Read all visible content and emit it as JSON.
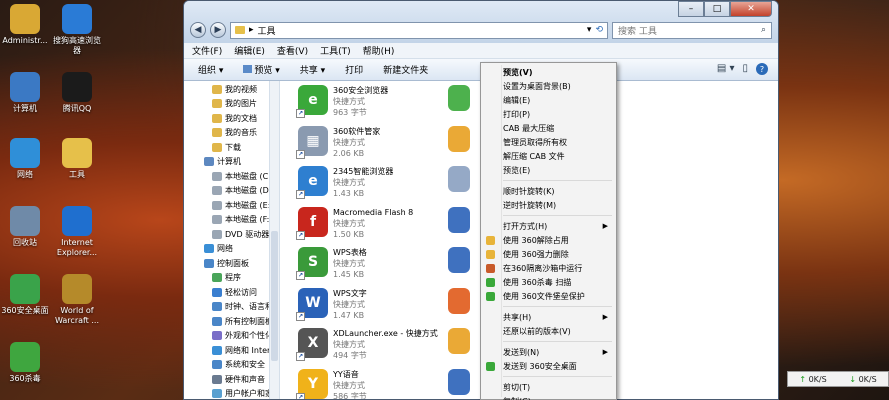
{
  "desktop": {
    "icons": [
      {
        "label": "Administr...",
        "glyph": "user-folder-icon",
        "color": "#d9a834"
      },
      {
        "label": "搜狗高速浏览器",
        "glyph": "sogou-browser-icon",
        "color": "#2a7bd6"
      },
      {
        "label": "计算机",
        "glyph": "computer-icon",
        "color": "#3b79c4"
      },
      {
        "label": "腾讯QQ",
        "glyph": "qq-penguin-icon",
        "color": "#1b1b1b"
      },
      {
        "label": "网络",
        "glyph": "network-globe-icon",
        "color": "#2f8fd8"
      },
      {
        "label": "工具",
        "glyph": "folder-icon",
        "color": "#e6c04a"
      },
      {
        "label": "回收站",
        "glyph": "recycle-bin-icon",
        "color": "#6f8aa8"
      },
      {
        "label": "Internet Explorer...",
        "glyph": "ie-icon",
        "color": "#1f6fcf"
      },
      {
        "label": "360安全桌面",
        "glyph": "360-desktop-icon",
        "color": "#3aa34a"
      },
      {
        "label": "World of Warcraft ...",
        "glyph": "wow-icon",
        "color": "#b58a2a"
      },
      {
        "label": "360杀毒",
        "glyph": "360-antivirus-icon",
        "color": "#3fa63f"
      }
    ]
  },
  "window": {
    "address": "工具",
    "search_placeholder": "搜索 工具",
    "menubar": [
      "文件(F)",
      "编辑(E)",
      "查看(V)",
      "工具(T)",
      "帮助(H)"
    ],
    "toolbar": {
      "organize": "组织 ▾",
      "preview": "预览 ▾",
      "share": "共享 ▾",
      "print": "打印",
      "new_folder": "新建文件夹"
    },
    "nav_items": [
      {
        "label": "我的视频",
        "color": "#e0b64a",
        "indent": 1
      },
      {
        "label": "我的图片",
        "color": "#e0b64a",
        "indent": 1
      },
      {
        "label": "我的文档",
        "color": "#e0b64a",
        "indent": 1
      },
      {
        "label": "我的音乐",
        "color": "#e0b64a",
        "indent": 1
      },
      {
        "label": "下载",
        "color": "#e0b64a",
        "indent": 1
      },
      {
        "label": "计算机",
        "color": "#5d88c0",
        "indent": 0
      },
      {
        "label": "本地磁盘 (C:)",
        "color": "#9aa6b4",
        "indent": 1
      },
      {
        "label": "本地磁盘 (D:)",
        "color": "#9aa6b4",
        "indent": 1
      },
      {
        "label": "本地磁盘 (E:)",
        "color": "#9aa6b4",
        "indent": 1
      },
      {
        "label": "本地磁盘 (F:)",
        "color": "#9aa6b4",
        "indent": 1
      },
      {
        "label": "DVD 驱动器 (",
        "color": "#9aa6b4",
        "indent": 1
      },
      {
        "label": "网络",
        "color": "#3a8fd6",
        "indent": 0
      },
      {
        "label": "控制面板",
        "color": "#4a86c8",
        "indent": 0
      },
      {
        "label": "程序",
        "color": "#4aa55a",
        "indent": 1
      },
      {
        "label": "轻松访问",
        "color": "#3a7fd0",
        "indent": 1
      },
      {
        "label": "时钟、语言和",
        "color": "#4a86c8",
        "indent": 1
      },
      {
        "label": "所有控制面板",
        "color": "#4a86c8",
        "indent": 1
      },
      {
        "label": "外观和个性化",
        "color": "#7a6ec8",
        "indent": 1
      },
      {
        "label": "网络和 Intern",
        "color": "#3a8fd6",
        "indent": 1
      },
      {
        "label": "系统和安全",
        "color": "#4a86c8",
        "indent": 1
      },
      {
        "label": "硬件和声音",
        "color": "#6a7a90",
        "indent": 1
      },
      {
        "label": "用户帐户和家",
        "color": "#5aa0d0",
        "indent": 1
      }
    ],
    "files": [
      {
        "name": "360安全浏览器",
        "type": "快捷方式",
        "size": "963 字节",
        "color": "#3aa83a",
        "glyph": "e"
      },
      {
        "name": "360软件管家",
        "type": "快捷方式",
        "size": "2.06 KB",
        "color": "#8a9ab0",
        "glyph": "▦"
      },
      {
        "name": "2345智能浏览器",
        "type": "快捷方式",
        "size": "1.43 KB",
        "color": "#2e7fd0",
        "glyph": "e"
      },
      {
        "name": "Macromedia Flash 8",
        "type": "快捷方式",
        "size": "1.50 KB",
        "color": "#c8261d",
        "glyph": "f"
      },
      {
        "name": "WPS表格",
        "type": "快捷方式",
        "size": "1.45 KB",
        "color": "#3a9a3a",
        "glyph": "S"
      },
      {
        "name": "WPS文字",
        "type": "快捷方式",
        "size": "1.47 KB",
        "color": "#2a62b8",
        "glyph": "W"
      },
      {
        "name": "XDLauncher.exe - 快捷方式",
        "type": "快捷方式",
        "size": "494 字节",
        "color": "#555555",
        "glyph": "X"
      },
      {
        "name": "YY语音",
        "type": "快捷方式",
        "size": "586 字节",
        "color": "#f0b21a",
        "glyph": "Y"
      }
    ],
    "context_menu": [
      {
        "label": "预览(V)",
        "bold": true
      },
      {
        "label": "设置为桌面背景(B)"
      },
      {
        "label": "编辑(E)"
      },
      {
        "label": "打印(P)"
      },
      {
        "label": "CAB 最大压缩"
      },
      {
        "label": "管理员取得所有权"
      },
      {
        "label": "解压缩 CAB 文件"
      },
      {
        "label": "预览(E)"
      },
      {
        "sep": true
      },
      {
        "label": "顺时针旋转(K)"
      },
      {
        "label": "逆时针旋转(M)"
      },
      {
        "sep": true
      },
      {
        "label": "打开方式(H)",
        "submenu": true
      },
      {
        "label": "使用 360解除占用",
        "icon": "#e8b43a"
      },
      {
        "label": "使用 360强力删除",
        "icon": "#e8b43a"
      },
      {
        "label": "在360隔离沙箱中运行",
        "icon": "#c85a2a"
      },
      {
        "label": "使用 360杀毒 扫描",
        "icon": "#3aa83a"
      },
      {
        "label": "使用 360文件堡垒保护",
        "icon": "#3aa83a"
      },
      {
        "sep": true
      },
      {
        "label": "共享(H)",
        "submenu": true
      },
      {
        "label": "还原以前的版本(V)"
      },
      {
        "sep": true
      },
      {
        "label": "发送到(N)",
        "submenu": true
      },
      {
        "label": "发送到 360安全桌面",
        "icon": "#3aa83a"
      },
      {
        "sep": true
      },
      {
        "label": "剪切(T)"
      },
      {
        "label": "复制(C)"
      }
    ]
  },
  "net_widget": {
    "up": "0K/S",
    "down": "0K/S"
  }
}
